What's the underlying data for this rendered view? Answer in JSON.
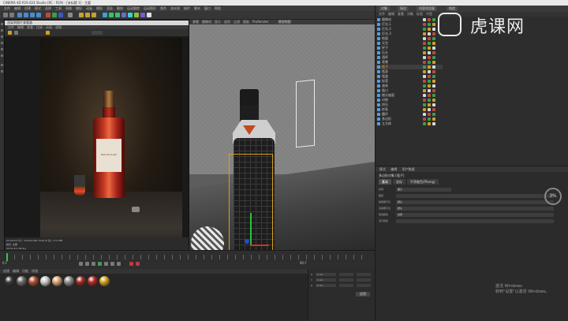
{
  "app": {
    "title": "CINEMA 4D R19.024 Studio (RC - R19) - [未标题 1] - 主要",
    "menus": [
      "文件",
      "编辑",
      "创建",
      "模式",
      "选择",
      "工具",
      "网格",
      "捕捉",
      "动画",
      "模拟",
      "渲染",
      "雕刻",
      "运动跟踪",
      "运动图形",
      "角色",
      "流水线",
      "插件",
      "脚本",
      "窗口",
      "帮助"
    ]
  },
  "render_window": {
    "title": "渲染到图片查看器",
    "menus": [
      "文件",
      "编辑",
      "查看",
      "比较",
      "动画",
      "滤镜"
    ],
    "label_text": "MACALLAN",
    "status_lines": [
      "00:00:59 大小: 1024x1280, RGB (8 位), 3.72 MB",
      "模式: 全部",
      "00:01:41 (58.9s)"
    ]
  },
  "viewport": {
    "label": "透视视图",
    "menus": [
      "查看",
      "摄像机",
      "显示",
      "选项",
      "过滤",
      "面板",
      "ProRender"
    ]
  },
  "timeline": {
    "status": "00:00:03 ... 56.8 对象 ...",
    "frame_start": "0 F",
    "frame_end": "90 F"
  },
  "materials": {
    "menus": [
      "创建",
      "编辑",
      "功能",
      "纹理"
    ],
    "balls": [
      {
        "color": "#3a3a3a"
      },
      {
        "color": "#6a6a6a"
      },
      {
        "color": "#b05030"
      },
      {
        "color": "#c8c8c8"
      },
      {
        "color": "#d9a070"
      },
      {
        "color": "#8a8a8a"
      },
      {
        "color": "#9a2a20"
      },
      {
        "color": "#b02a24"
      },
      {
        "color": "#d0a020"
      }
    ]
  },
  "coords": {
    "rows": [
      {
        "axis": "X",
        "value": "0 cm"
      },
      {
        "axis": "Y",
        "value": "0 cm"
      },
      {
        "axis": "Z",
        "value": "0 cm"
      }
    ],
    "apply_label": "应用"
  },
  "object_manager": {
    "tabs": [
      "对象",
      "场次",
      "内容浏览器",
      "构造"
    ],
    "menus": [
      "文件",
      "编辑",
      "查看",
      "对象",
      "标签",
      "书签"
    ],
    "objects": [
      {
        "name": "摄像机",
        "selected": false
      },
      {
        "name": "灯光.1",
        "selected": false
      },
      {
        "name": "灯光.2",
        "selected": false
      },
      {
        "name": "灯光.3",
        "selected": false
      },
      {
        "name": "地面",
        "selected": false
      },
      {
        "name": "天空",
        "selected": false
      },
      {
        "name": "杯子",
        "selected": false
      },
      {
        "name": "石头",
        "selected": false
      },
      {
        "name": "酒杯",
        "selected": false
      },
      {
        "name": "背景",
        "selected": false
      },
      {
        "name": "瓶子",
        "selected": true
      },
      {
        "name": "瓶身",
        "selected": false
      },
      {
        "name": "瓶盖",
        "selected": false
      },
      {
        "name": "标签",
        "selected": false
      },
      {
        "name": "液体",
        "selected": false
      },
      {
        "name": "瓶口",
        "selected": false
      },
      {
        "name": "细分曲面",
        "selected": false
      },
      {
        "name": "对称",
        "selected": false
      },
      {
        "name": "挤压",
        "selected": false
      },
      {
        "name": "样条",
        "selected": false
      },
      {
        "name": "圆环",
        "selected": false
      },
      {
        "name": "多边形",
        "selected": false
      },
      {
        "name": "立方体",
        "selected": false
      }
    ]
  },
  "attribute_manager": {
    "tabs": [
      "模式",
      "编辑",
      "用户数据"
    ],
    "title": "多边形对象 [瓶子]",
    "subtabs": [
      "基本",
      "坐标",
      "平滑着色(Phong)"
    ],
    "rows": [
      {
        "label": "名称",
        "value": "瓶子"
      },
      {
        "label": "图层",
        "value": ""
      },
      {
        "label": "编辑器可见",
        "value": "默认"
      },
      {
        "label": "渲染器可见",
        "value": "默认"
      },
      {
        "label": "使用颜色",
        "value": "关闭"
      },
      {
        "label": "显示颜色",
        "value": ""
      }
    ],
    "knob_text": "3%"
  },
  "branding": {
    "logo_text": "虎课网"
  },
  "watermark": {
    "line1": "激活 Windows",
    "line2": "转到\"设置\"以激活 Windows。"
  }
}
